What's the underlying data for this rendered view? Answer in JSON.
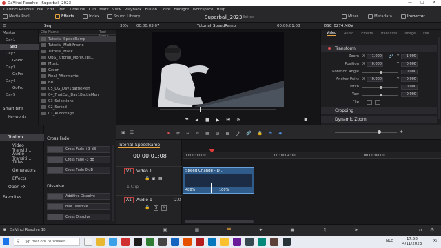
{
  "window": {
    "title": "DaVinci Resolve - Superball_2023"
  },
  "menu": [
    "DaVinci Resolve",
    "File",
    "Edit",
    "Trim",
    "Timeline",
    "Clip",
    "Mark",
    "View",
    "Playback",
    "Fusion",
    "Color",
    "Fairlight",
    "Workspace",
    "Help"
  ],
  "toolbar": {
    "media_pool": "Media Pool",
    "effects": "Effects",
    "index": "Index",
    "sound_library": "Sound Library",
    "project_title": "Superball_2023",
    "edited": "Edited",
    "mixer": "Mixer",
    "metadata": "Metadata",
    "inspector": "Inspector"
  },
  "row2": {
    "zoom": "30%",
    "source_tc": "00:00:03:07",
    "timeline_name": "Tutorial_SpeedRamp",
    "record_tc": "00:00:01:08",
    "clip_file": "DSC_0274.MOV"
  },
  "bins": {
    "header_seq": "Seq",
    "items": [
      "Master",
      "Day1",
      "Seq",
      "Day2",
      "GoPro",
      "Day3",
      "GoPro",
      "Day4",
      "GoPro",
      "Day5"
    ],
    "smart_bins": "Smart Bins",
    "keywords": "Keywords"
  },
  "clip_list": {
    "col_clip": "Clip Name",
    "col_reel": "Reel Name",
    "rows": [
      "Tutorial_SpeedRamp",
      "Tutorial_MultiFrame",
      "Tutorial_Mask",
      "OBS_Tutorial_MoreClips...",
      "Music",
      "Green",
      "Final_Aftermovie",
      "BU",
      "05_CG_Day1BattleMen",
      "04_FirstCut_Day1BattleMen",
      "03_Selections",
      "02_Sorted",
      "01_AllFootage"
    ]
  },
  "inspector": {
    "tabs": [
      "Video",
      "Audio",
      "Effects",
      "Transition",
      "Image",
      "File"
    ],
    "transform_title": "Transform",
    "zoom_label": "Zoom",
    "zoom_x": "1.000",
    "zoom_y": "1.000",
    "position_label": "Position",
    "position_x": "0.000",
    "position_y": "0.000",
    "rotation_label": "Rotation Angle",
    "rotation": "0.000",
    "anchor_label": "Anchor Point",
    "anchor_x": "0.000",
    "anchor_y": "0.000",
    "pitch_label": "Pitch",
    "pitch": "0.000",
    "yaw_label": "Yaw",
    "yaw": "0.000",
    "flip_label": "Flip",
    "cropping": "Cropping",
    "dynamic_zoom": "Dynamic Zoom"
  },
  "effects": {
    "toolbox": "Toolbox",
    "items": [
      "Video Transiti...",
      "Audio Transiti...",
      "Titles",
      "Generators",
      "Effects",
      "Open FX"
    ],
    "favorites": "Favorites",
    "cross_fade_header": "Cross Fade",
    "cross_fade": [
      "Cross Fade +3 dB",
      "Cross Fade -3 dB",
      "Cross Fade 0 dB"
    ],
    "dissolve_header": "Dissolve",
    "dissolve": [
      "Additive Dissolve",
      "Blur Dissolve",
      "Cross Dissolve"
    ]
  },
  "timeline": {
    "tab": "Tutorial_SpeedRamp",
    "timecode": "00:00:01:08",
    "ruler": [
      "00:00:00:00",
      "00:00:04:00",
      "00:00:08:00"
    ],
    "video_track_id": "V1",
    "video_track_name": "Video 1",
    "video_clips": "1 Clip",
    "audio_track_id": "A1",
    "audio_track_name": "Audio 1",
    "audio_level": "2.0",
    "clip_label": "Speed Change - D...",
    "speed_left": "488%",
    "speed_right": "100%"
  },
  "footer": {
    "app_version": "DaVinci Resolve 18"
  },
  "taskbar": {
    "search_placeholder": "Typ hier om te zoeken",
    "lang": "NLD",
    "time": "17:58",
    "date": "4/11/2023"
  },
  "colors": {
    "accent_orange": "#e8a23a",
    "playhead": "#e03b3b",
    "clip_blue": "#2f5c8a"
  }
}
